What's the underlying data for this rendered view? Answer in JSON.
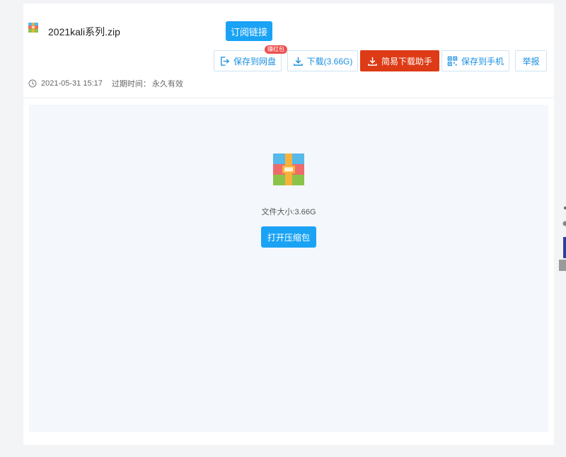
{
  "file": {
    "name": "2021kali系列.zip",
    "date": "2021-05-31 15:17",
    "expire_label": "过期时间：",
    "expire_value": "永久有效"
  },
  "header": {
    "subscribe_label": "订阅链接"
  },
  "toolbar": {
    "save_label": "保存到网盘",
    "save_badge": "赚红包",
    "download_label": "下载(3.66G)",
    "assistant_label": "简易下载助手",
    "phone_label": "保存到手机",
    "report_label": "举报"
  },
  "preview": {
    "size_text": "文件大小:3.66G",
    "open_label": "打开压缩包"
  },
  "colors": {
    "accent": "#1aa3f5",
    "assistant_bg": "#dd3b16",
    "badge": "#ee5050"
  },
  "icons": {
    "archive": "archive-icon",
    "save": "cloud-save-icon",
    "download": "download-icon",
    "phone": "qr-phone-icon",
    "clock": "clock-icon"
  }
}
